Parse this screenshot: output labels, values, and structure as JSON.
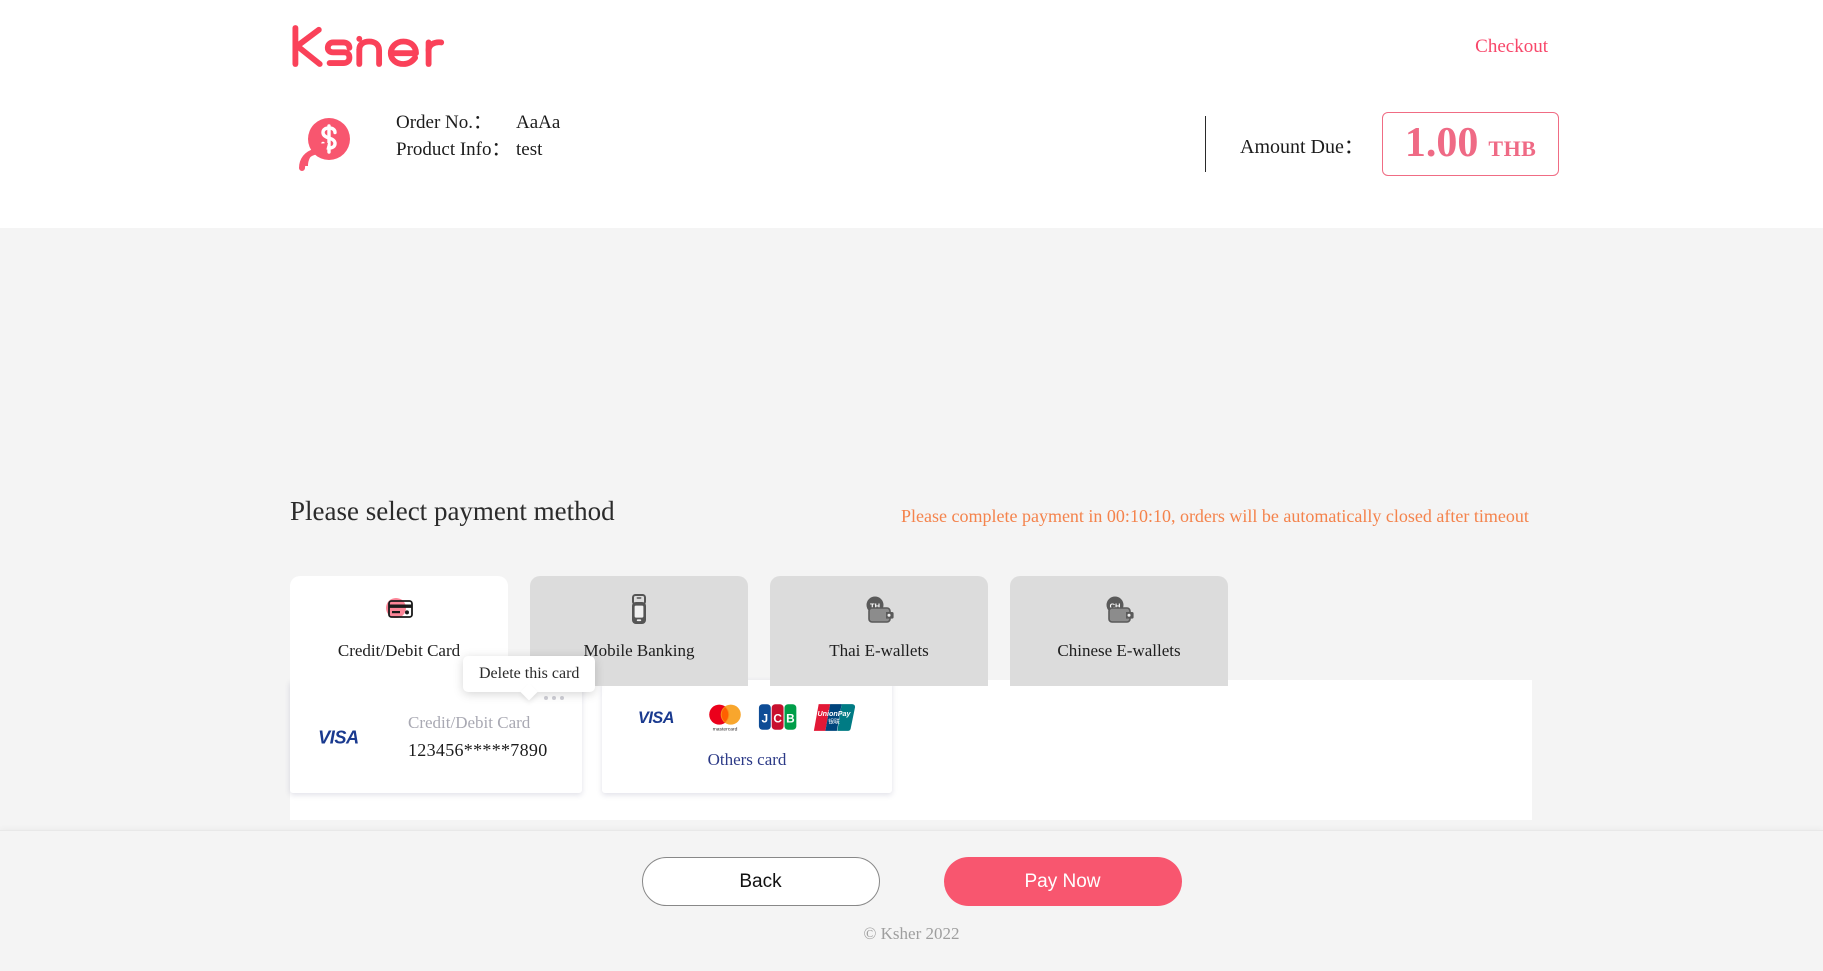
{
  "header": {
    "logo_text": "Ksher",
    "checkout_label": "Checkout",
    "brand_color": "#f8476a",
    "order": {
      "order_no_label": "Order No.：",
      "order_no_value": "AaAa",
      "product_info_label": "Product Info：",
      "product_info_value": "test",
      "coin_icon": "dollar-coin-cursor-icon"
    },
    "amount": {
      "label": "Amount Due：",
      "value": "1.00",
      "currency": "THB",
      "accent_color": "#ef6a85"
    }
  },
  "main": {
    "section_title": "Please select payment method",
    "countdown_notice": "Please complete payment in 00:10:10, orders will be automatically closed after timeout",
    "countdown_color": "#f4834c",
    "tabs": [
      {
        "label": "Credit/Debit Card",
        "icon": "credit-card-icon",
        "active": true
      },
      {
        "label": "Mobile Banking",
        "icon": "mobile-phone-icon",
        "active": false
      },
      {
        "label": "Thai E-wallets",
        "icon": "wallet-th-icon",
        "active": false
      },
      {
        "label": "Chinese E-wallets",
        "icon": "wallet-ch-icon",
        "active": false
      }
    ],
    "saved_card": {
      "brand_icon": "visa-logo",
      "type_label": "Credit/Debit Card",
      "masked_number": "123456*****7890",
      "menu_icon": "ellipsis-icon"
    },
    "tooltip": {
      "text": "Delete this card"
    },
    "others_card": {
      "label": "Others card",
      "brands": [
        "visa-logo",
        "mastercard-logo",
        "jcb-logo",
        "unionpay-logo"
      ]
    }
  },
  "footer": {
    "back_label": "Back",
    "pay_label": "Pay Now",
    "copyright": "© Ksher 2022",
    "pay_color": "#f8566f"
  }
}
